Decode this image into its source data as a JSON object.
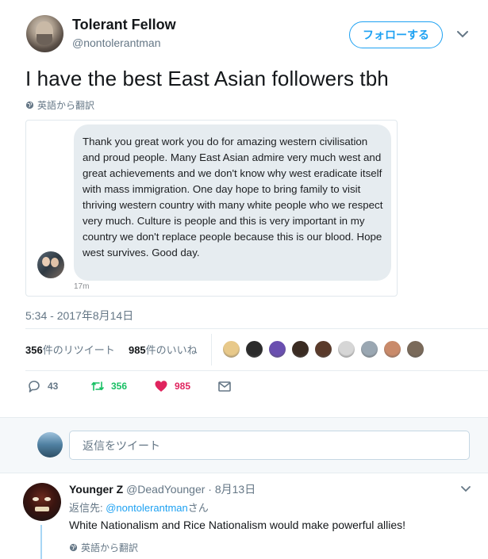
{
  "author": {
    "name": "Tolerant Fellow",
    "handle": "@nontolerantman",
    "follow_label": "フォローする"
  },
  "tweet": {
    "text": "I have the best East Asian followers tbh",
    "translate_label": "英語から翻訳",
    "timestamp": "5:34 - 2017年8月14日"
  },
  "embedded_message": {
    "text": "Thank you great work you do for amazing western civilisation and proud people. Many East Asian admire very much west and great achievements and we don't know why west eradicate itself with mass immigration. One day hope to bring family to visit thriving western country with many white people who we respect very much. Culture is people and this is very important in my country we don't replace people because this is our blood. Hope west survives. Good day.",
    "time": "17m"
  },
  "stats": {
    "retweets_count": "356",
    "retweets_label": "件のリツイート",
    "likes_count": "985",
    "likes_label": "件のいいね",
    "liker_colors": [
      "#e8c98a",
      "#2b2b2b",
      "#6a4fb0",
      "#3a2b22",
      "#5a3a2a",
      "#d6d6d6",
      "#9aa7b2",
      "#c98a6a",
      "#7a6a5a"
    ]
  },
  "actions": {
    "reply_count": "43",
    "retweet_count": "356",
    "like_count": "985",
    "reply_color": "#657786",
    "retweet_color": "#17bf63",
    "like_color": "#e0245e"
  },
  "reply_box": {
    "placeholder": "返信をツイート"
  },
  "reply": {
    "name": "Younger Z",
    "handle": "@DeadYounger",
    "separator": "·",
    "date": "8月13日",
    "replying_prefix": "返信先: ",
    "replying_handle": "@nontolerantman",
    "replying_suffix": "さん",
    "text": "White Nationalism and Rice Nationalism would make powerful allies!",
    "translate_label": "英語から翻訳"
  }
}
